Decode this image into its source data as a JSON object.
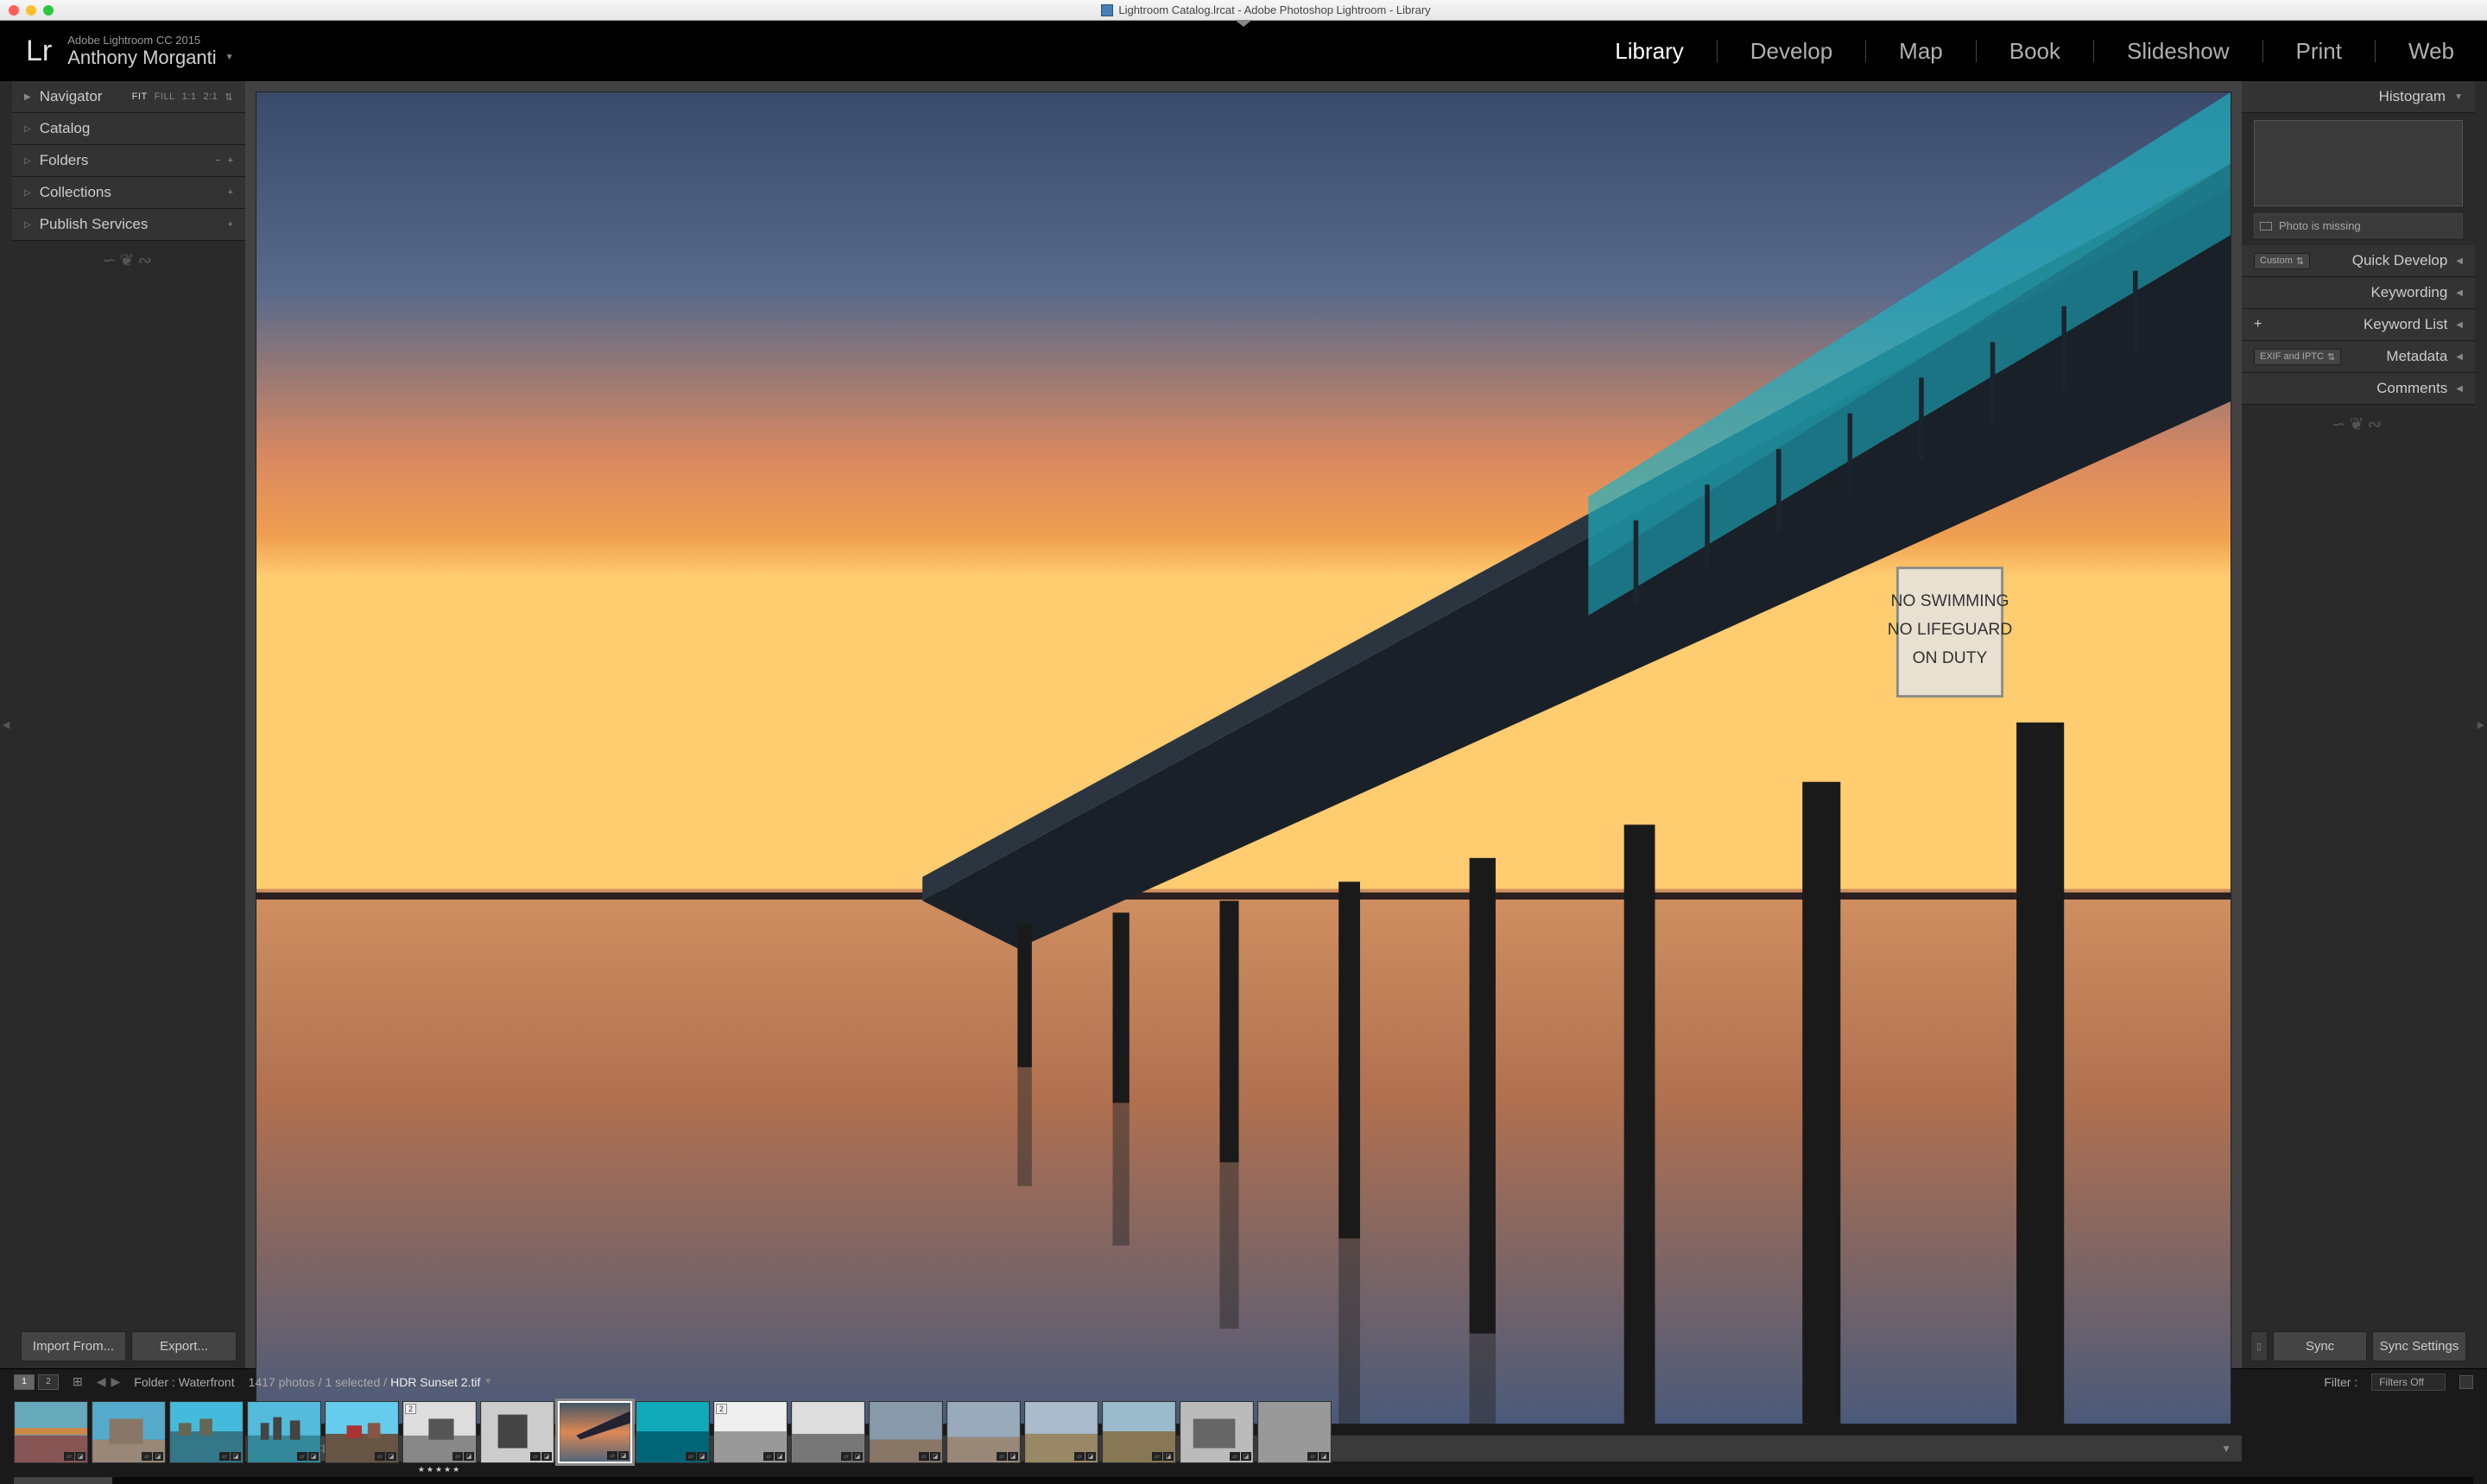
{
  "titlebar": {
    "title": "Lightroom Catalog.lrcat - Adobe Photoshop Lightroom - Library"
  },
  "header": {
    "logo": "Lr",
    "version": "Adobe Lightroom CC 2015",
    "user": "Anthony Morganti",
    "modules": [
      "Library",
      "Develop",
      "Map",
      "Book",
      "Slideshow",
      "Print",
      "Web"
    ],
    "active_module": "Library"
  },
  "left_panel": {
    "navigator": {
      "label": "Navigator",
      "opts": [
        "FIT",
        "FILL",
        "1:1",
        "2:1"
      ],
      "active": "FIT"
    },
    "sections": [
      {
        "label": "Catalog"
      },
      {
        "label": "Folders",
        "buttons": [
          "−",
          "+"
        ]
      },
      {
        "label": "Collections",
        "buttons": [
          "+"
        ]
      },
      {
        "label": "Publish Services",
        "buttons": [
          "+"
        ]
      }
    ],
    "import_btn": "Import From...",
    "export_btn": "Export..."
  },
  "right_panel": {
    "histogram": {
      "label": "Histogram"
    },
    "missing": "Photo is missing",
    "quick_develop": {
      "label": "Quick Develop",
      "preset": "Custom"
    },
    "sections": [
      {
        "label": "Keywording"
      },
      {
        "label": "Keyword List",
        "left_btn": "+"
      },
      {
        "label": "Metadata",
        "preset": "EXIF and IPTC"
      },
      {
        "label": "Comments"
      }
    ],
    "sync": "Sync",
    "sync_settings": "Sync Settings"
  },
  "toolbar": {
    "stars": "★★★★★"
  },
  "filmbar": {
    "view1": "1",
    "view2": "2",
    "path_label": "Folder :",
    "path_value": "Waterfront",
    "count": "1417 photos /",
    "selected": "1 selected /",
    "filename": "HDR Sunset 2.tif",
    "filter_label": "Filter :",
    "filter_value": "Filters Off"
  },
  "filmstrip": {
    "thumbs": [
      {
        "type": "bridge"
      },
      {
        "type": "building"
      },
      {
        "type": "harbor"
      },
      {
        "type": "skyline"
      },
      {
        "type": "town"
      },
      {
        "type": "bw",
        "stack": "2",
        "stars": "★★★★★"
      },
      {
        "type": "bw2"
      },
      {
        "type": "pier",
        "selected": true,
        "active": true
      },
      {
        "type": "water"
      },
      {
        "type": "bw3",
        "stack": "2"
      },
      {
        "type": "bw4"
      },
      {
        "type": "clouds"
      },
      {
        "type": "clouds2"
      },
      {
        "type": "field"
      },
      {
        "type": "trees"
      },
      {
        "type": "industrial"
      },
      {
        "type": "edge"
      }
    ]
  }
}
